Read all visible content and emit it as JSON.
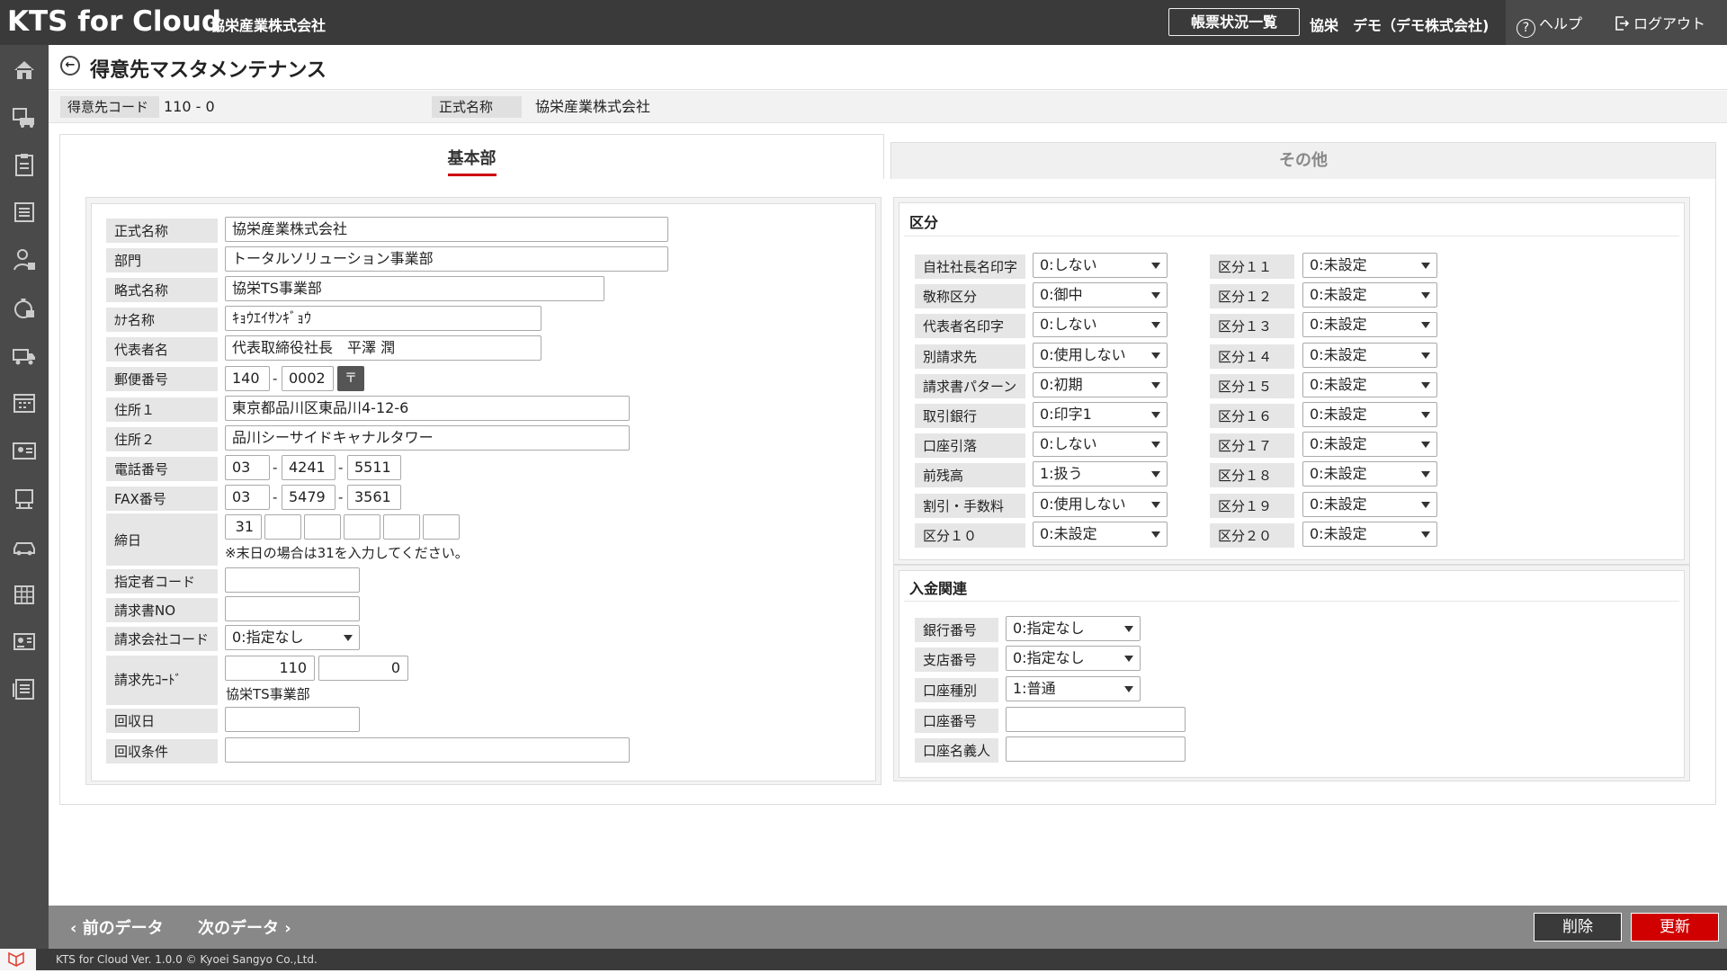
{
  "header": {
    "app_title": "KTS for Cloud",
    "company": "協栄産業株式会社",
    "report_button": "帳票状況一覧",
    "user": "協栄　デモ（デモ株式会社)",
    "help": "ヘルプ",
    "logout": "ログアウト"
  },
  "page": {
    "title": "得意先マスタメンテナンス",
    "code_label": "得意先コード",
    "code_value": "110 - 0",
    "name_label": "正式名称",
    "name_value": "協栄産業株式会社"
  },
  "tabs": {
    "basic": "基本部",
    "other": "その他"
  },
  "basic": {
    "official_name": {
      "label": "正式名称",
      "value": "協栄産業株式会社"
    },
    "department": {
      "label": "部門",
      "value": "トータルソリューション事業部"
    },
    "short_name": {
      "label": "略式名称",
      "value": "協栄TS事業部"
    },
    "kana_name": {
      "label": "ｶﾅ名称",
      "value": "ｷｮｳｴｲｻﾝｷﾞｮｳ"
    },
    "representative": {
      "label": "代表者名",
      "value": "代表取締役社長　平澤 潤"
    },
    "postal": {
      "label": "郵便番号",
      "part1": "140",
      "part2": "0002",
      "button": "〒"
    },
    "address1": {
      "label": "住所１",
      "value": "東京都品川区東品川4-12-6"
    },
    "address2": {
      "label": "住所２",
      "value": "品川シーサイドキャナルタワー"
    },
    "phone": {
      "label": "電話番号",
      "p1": "03",
      "p2": "4241",
      "p3": "5511"
    },
    "fax": {
      "label": "FAX番号",
      "p1": "03",
      "p2": "5479",
      "p3": "3561"
    },
    "closing": {
      "label": "締日",
      "day1": "31",
      "note": "※末日の場合は31を入力してください。"
    },
    "designator_code": {
      "label": "指定者コード",
      "value": ""
    },
    "invoice_no": {
      "label": "請求書NO",
      "value": ""
    },
    "billing_company": {
      "label": "請求会社コード",
      "value": "0:指定なし"
    },
    "billing_code": {
      "label": "請求先ｺｰﾄﾞ",
      "v1": "110",
      "v2": "0",
      "name": "協栄TS事業部"
    },
    "collection_day": {
      "label": "回収日",
      "value": ""
    },
    "collection_terms": {
      "label": "回収条件",
      "value": ""
    },
    "dash": "-"
  },
  "category": {
    "title": "区分",
    "left": [
      {
        "label": "自社社長名印字",
        "value": "0:しない"
      },
      {
        "label": "敬称区分",
        "value": "0:御中"
      },
      {
        "label": "代表者名印字",
        "value": "0:しない"
      },
      {
        "label": "別請求先",
        "value": "0:使用しない"
      },
      {
        "label": "請求書パターン",
        "value": "0:初期"
      },
      {
        "label": "取引銀行",
        "value": "0:印字1"
      },
      {
        "label": "口座引落",
        "value": "0:しない"
      },
      {
        "label": "前残高",
        "value": "1:扱う"
      },
      {
        "label": "割引・手数料",
        "value": "0:使用しない"
      },
      {
        "label": "区分１０",
        "value": "0:未設定"
      }
    ],
    "right": [
      {
        "label": "区分１１",
        "value": "0:未設定"
      },
      {
        "label": "区分１２",
        "value": "0:未設定"
      },
      {
        "label": "区分１３",
        "value": "0:未設定"
      },
      {
        "label": "区分１４",
        "value": "0:未設定"
      },
      {
        "label": "区分１５",
        "value": "0:未設定"
      },
      {
        "label": "区分１６",
        "value": "0:未設定"
      },
      {
        "label": "区分１７",
        "value": "0:未設定"
      },
      {
        "label": "区分１８",
        "value": "0:未設定"
      },
      {
        "label": "区分１９",
        "value": "0:未設定"
      },
      {
        "label": "区分２０",
        "value": "0:未設定"
      }
    ]
  },
  "payment": {
    "title": "入金関連",
    "bank_no": {
      "label": "銀行番号",
      "value": "0:指定なし"
    },
    "branch_no": {
      "label": "支店番号",
      "value": "0:指定なし"
    },
    "account_type": {
      "label": "口座種別",
      "value": "1:普通"
    },
    "account_no": {
      "label": "口座番号",
      "value": ""
    },
    "account_holder": {
      "label": "口座名義人",
      "value": ""
    }
  },
  "footer": {
    "prev": "前のデータ",
    "next": "次のデータ",
    "delete": "削除",
    "update": "更新",
    "copyright": "KTS for Cloud Ver. 1.0.0 © Kyoei Sangyo Co.,Ltd."
  }
}
